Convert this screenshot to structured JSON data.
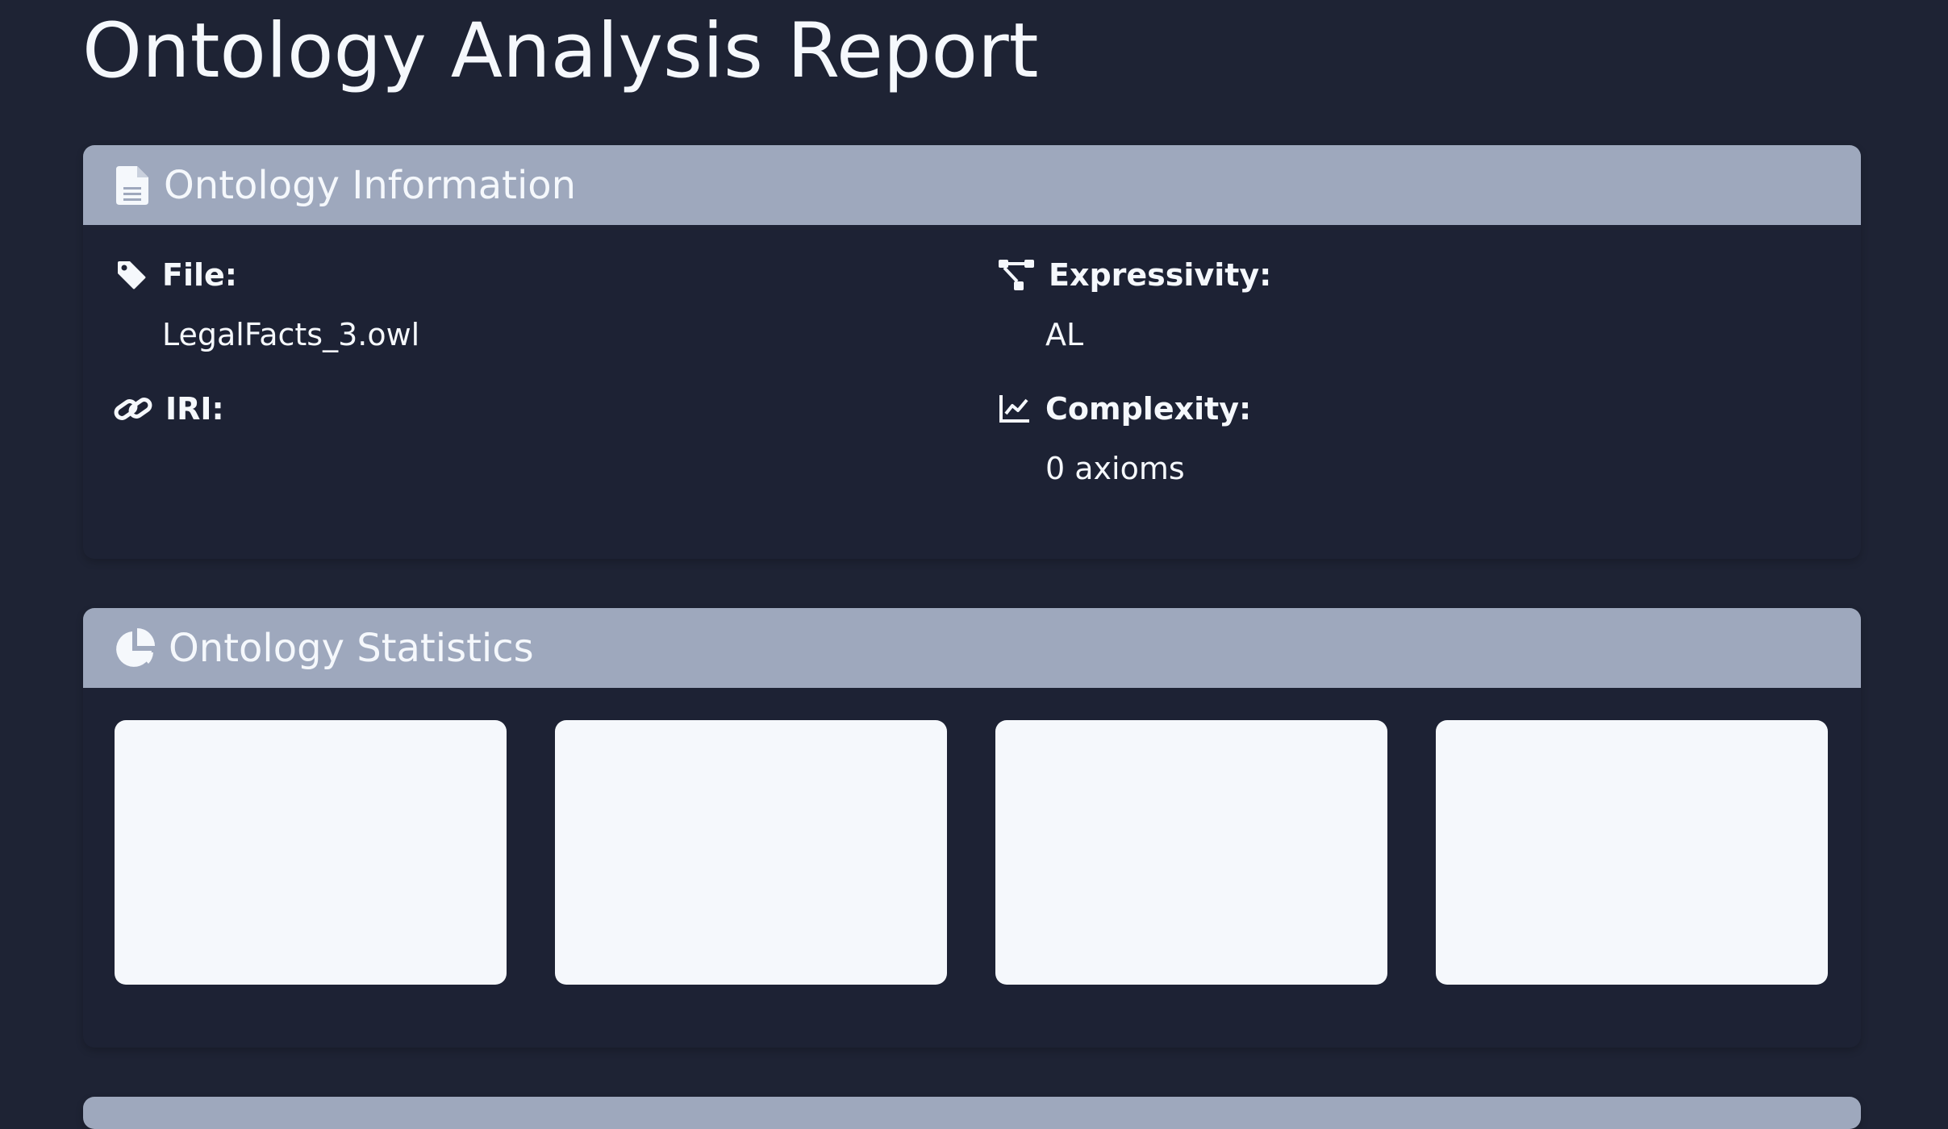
{
  "page": {
    "title": "Ontology Analysis Report"
  },
  "info_section": {
    "title": "Ontology Information",
    "icon": "file-document-icon",
    "items": {
      "file": {
        "label": "File:",
        "value": "LegalFacts_3.owl",
        "icon": "tag-icon"
      },
      "iri": {
        "label": "IRI:",
        "value": "",
        "icon": "link-icon"
      },
      "expressivity": {
        "label": "Expressivity:",
        "value": "AL",
        "icon": "sitemap-icon"
      },
      "complexity": {
        "label": "Complexity:",
        "value": "0 axioms",
        "icon": "chart-line-icon"
      }
    }
  },
  "stats_section": {
    "title": "Ontology Statistics",
    "icon": "pie-chart-icon",
    "cards_count": 4
  },
  "colors": {
    "background": "#1e2334",
    "header_band": "#9ea8bd",
    "text": "#f5f8fc",
    "stat_card": "#f5f8fc"
  }
}
